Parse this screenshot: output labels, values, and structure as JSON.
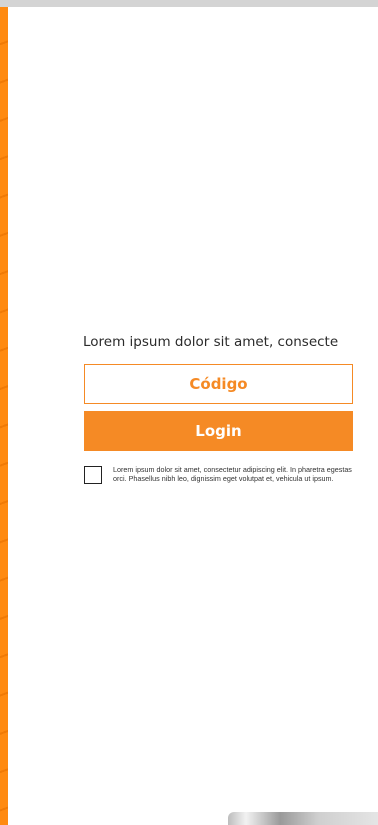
{
  "login": {
    "intro_text": "Lorem ipsum dolor sit amet, consecte",
    "code_placeholder": "Código",
    "login_label": "Login",
    "terms_text": "Lorem ipsum dolor sit amet, consectetur adipiscing elit. In pharetra egestas orci. Phasellus nibh leo, dignissim eget volutpat et, vehicula ut ipsum.",
    "terms_checked": false
  },
  "colors": {
    "accent": "#f58a25",
    "stripe": "#ff8a10",
    "top_bar": "#d4d4d4"
  }
}
